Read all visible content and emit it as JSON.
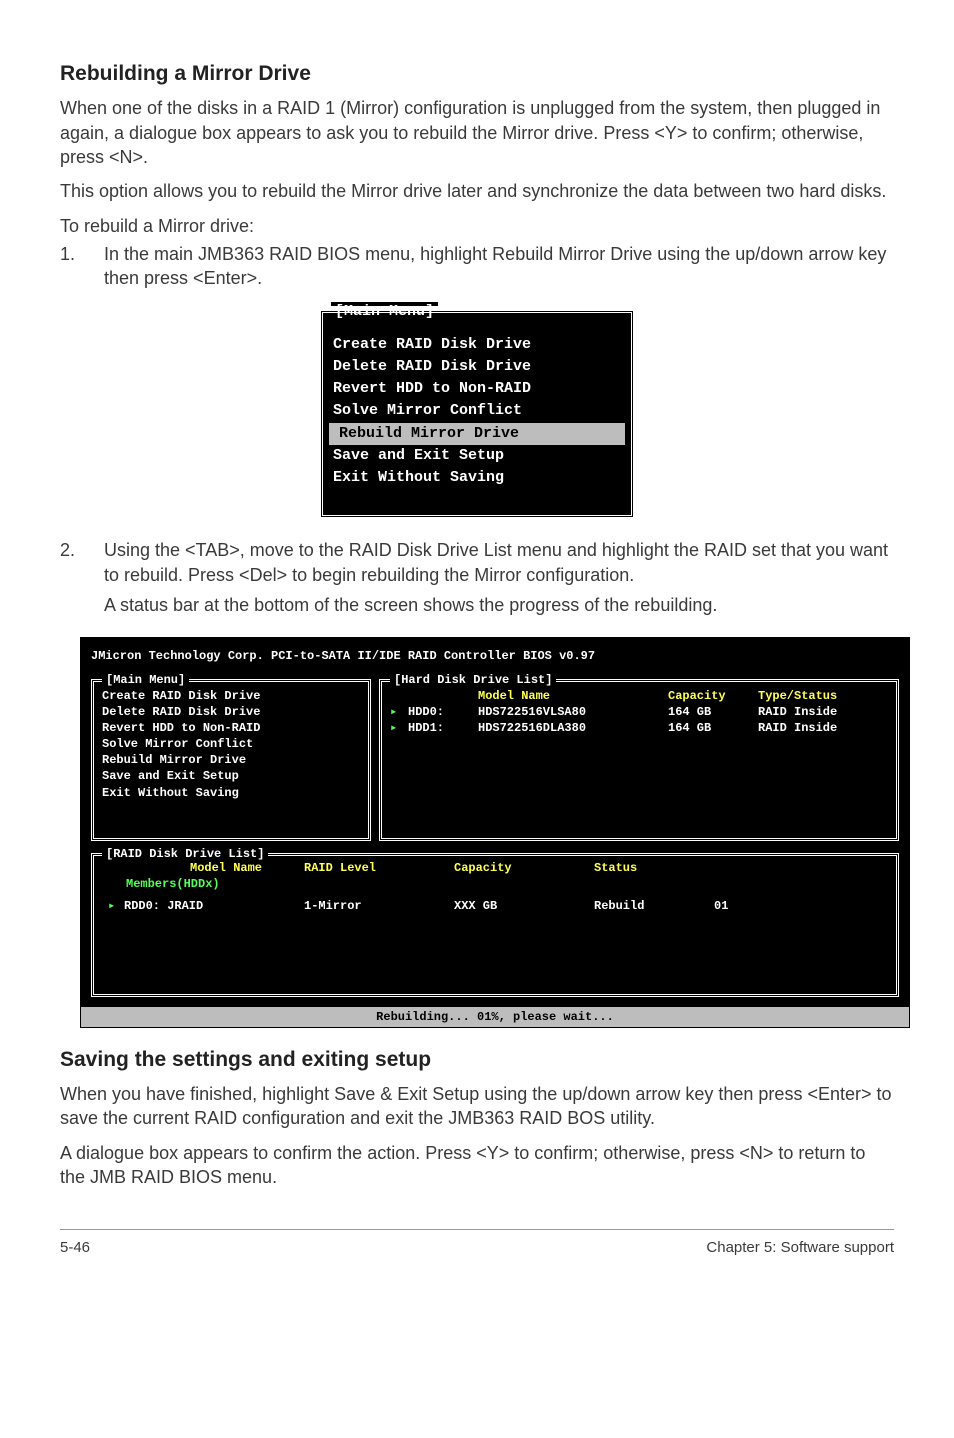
{
  "heading1": "Rebuilding a Mirror Drive",
  "paragraph1": "When one of the disks in a RAID 1 (Mirror) configuration is unplugged from the system, then plugged in again, a dialogue box appears to ask you to rebuild the Mirror drive. Press <Y> to confirm; otherwise, press <N>.",
  "paragraph2": "This option allows you to rebuild the Mirror drive later and synchronize the data between two hard disks.",
  "paragraph3": "To rebuild a Mirror drive:",
  "step1_num": "1.",
  "step1_text": "In the main JMB363 RAID BIOS menu, highlight Rebuild Mirror Drive using the up/down arrow key then press <Enter>.",
  "bios_small": {
    "title": "[Main Menu]",
    "items": [
      "Create RAID Disk Drive",
      "Delete RAID Disk Drive",
      "Revert HDD to Non-RAID",
      "Solve Mirror Conflict",
      "Rebuild Mirror Drive",
      "Save and Exit Setup",
      "Exit Without Saving"
    ],
    "selected_index": 4
  },
  "step2_num": "2.",
  "step2_text1": "Using the <TAB>, move to the RAID Disk Drive List menu and highlight the RAID set that you want to rebuild. Press <Del> to begin rebuilding the Mirror configuration.",
  "step2_text2": "A status bar at the bottom of the screen shows the progress of the rebuilding.",
  "bios_large": {
    "top": "JMicron Technology Corp. PCI-to-SATA II/IDE RAID Controller BIOS v0.97",
    "main_title": "[Main Menu]",
    "main_items": [
      "Create RAID Disk Drive",
      "Delete RAID Disk Drive",
      "Revert HDD to Non-RAID",
      "Solve Mirror Conflict",
      "Rebuild Mirror Drive",
      "Save and Exit Setup",
      "Exit Without Saving"
    ],
    "hdd_title": "[Hard Disk Drive List]",
    "hdd_headers": {
      "c1": "",
      "c2": "Model Name",
      "c3": "Capacity",
      "c4": "Type/Status"
    },
    "hdd_rows": [
      {
        "c1": "HDD0:",
        "c2": "HDS722516VLSA80",
        "c3": "164 GB",
        "c4": "RAID Inside"
      },
      {
        "c1": "HDD1:",
        "c2": "HDS722516DLA380",
        "c3": "164 GB",
        "c4": "RAID Inside"
      }
    ],
    "raid_title": "[RAID Disk Drive List]",
    "raid_headers": {
      "h1": "Model Name",
      "h2": "RAID Level",
      "h3": "Capacity",
      "h4": "Status"
    },
    "raid_members": "Members(HDDx)",
    "raid_row": {
      "d1": "RDD0:  JRAID",
      "d2": "1-Mirror",
      "d3": "XXX GB",
      "d4": "Rebuild",
      "d5": "01"
    },
    "status": "Rebuilding... 01%, please wait..."
  },
  "heading2": "Saving the settings and exiting setup",
  "paragraph4": "When you have finished, highlight Save & Exit Setup using the up/down arrow key then press <Enter> to save the current RAID configuration and exit the JMB363 RAID BOS utility.",
  "paragraph5": "A dialogue box appears to confirm the action. Press <Y> to confirm; otherwise, press <N> to return to the JMB RAID BIOS menu.",
  "footer_left": "5-46",
  "footer_right": "Chapter 5: Software support"
}
